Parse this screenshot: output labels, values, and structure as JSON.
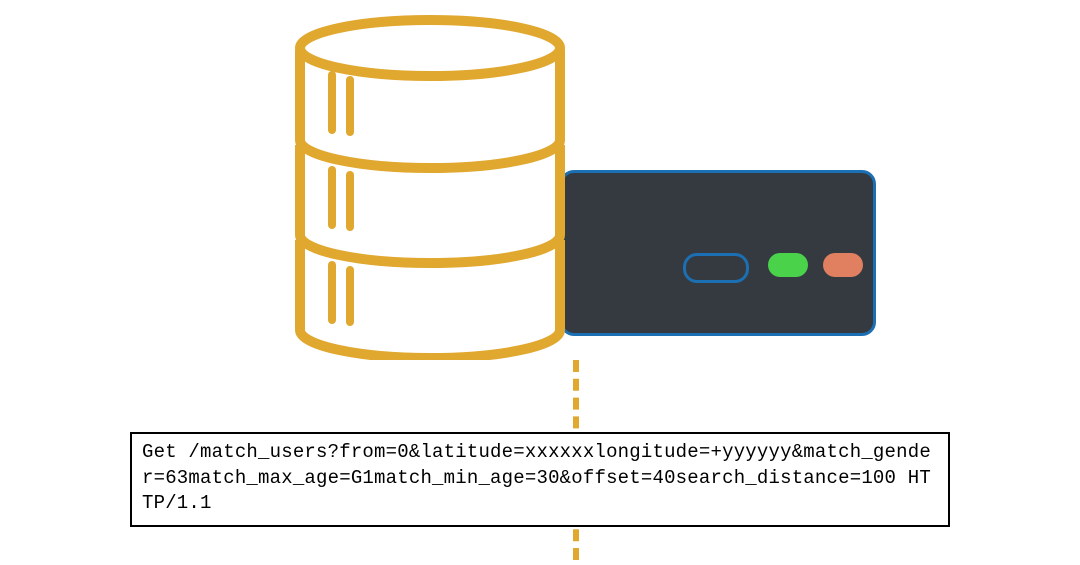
{
  "colors": {
    "accent_db": "#e0a82f",
    "server_body": "#343a40",
    "server_stroke": "#1b6fb2",
    "led_green": "#4bd24b",
    "led_orange": "#e08060",
    "request_border": "#000000"
  },
  "diagram": {
    "components": {
      "database": {
        "kind": "cylinder-stack",
        "color": "accent_db"
      },
      "server": {
        "kind": "rack-unit",
        "leds": [
          "green",
          "orange"
        ],
        "slot": true
      },
      "link": {
        "style": "dashed",
        "from": "server",
        "to": "request"
      }
    }
  },
  "request": {
    "method": "Get",
    "path": "/match_users",
    "query_raw": "from=0&latitude=xxxxxxlongitude=+yyyyyy&match_gender=63match_max_age=G1match_min_age=30&offset=40search_distance=100",
    "protocol": "HTTP/1.1",
    "display": "Get /match_users?from=0&latitude=xxxxxxlongitude=+yyyyyy&match_gender=63match_max_age=G1match_min_age=30&offset=40search_distance=100 HTTP/1.1",
    "params": {
      "from": "0",
      "latitude": "xxxxxx",
      "longitude": "+yyyyyy",
      "match_gender": "63",
      "match_max_age": "G1",
      "match_min_age": "30",
      "offset": "40",
      "search_distance": "100"
    }
  }
}
